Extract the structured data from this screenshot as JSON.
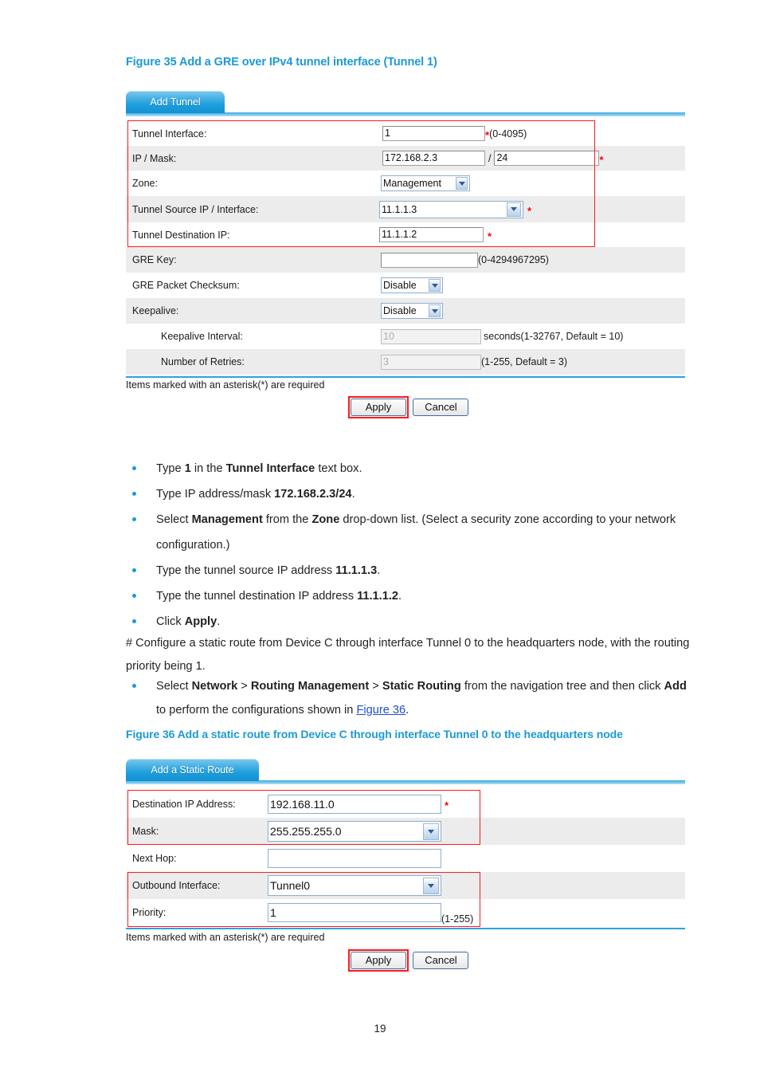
{
  "page": {
    "number": "19"
  },
  "figure35": {
    "caption": "Figure 35 Add a GRE over IPv4 tunnel interface (Tunnel 1)",
    "tab_label": "Add Tunnel",
    "rows": [
      {
        "label": "Tunnel Interface:",
        "value": "1",
        "required": "*",
        "hint": "(0-4095)"
      },
      {
        "label": "IP / Mask:",
        "value": "172.168.2.3",
        "mask": "24",
        "separator": "/",
        "required": "*"
      },
      {
        "label": "Zone:",
        "value": "Management"
      },
      {
        "label": "Tunnel Source IP / Interface:",
        "value": "11.1.1.3",
        "required": "*"
      },
      {
        "label": "Tunnel Destination IP:",
        "value": "11.1.1.2",
        "required": "*"
      },
      {
        "label": "GRE Key:",
        "value": "",
        "hint": "(0-4294967295)"
      },
      {
        "label": "GRE Packet Checksum:",
        "value": "Disable"
      },
      {
        "label": "Keepalive:",
        "value": "Disable"
      },
      {
        "label": "Keepalive Interval:",
        "value": "10",
        "hint": "seconds(1-32767, Default = 10)"
      },
      {
        "label": "Number of Retries:",
        "value": "3",
        "hint": "(1-255, Default = 3)"
      }
    ],
    "required_note": "Items marked with an asterisk(*) are required",
    "apply_label": "Apply",
    "cancel_label": "Cancel"
  },
  "steps1": [
    "Type <b>1</b> in the <b>Tunnel Interface</b> text box.",
    "Type IP address/mask <b>172.168.2.3/24</b>.",
    "Select <b>Management</b> from the <b>Zone</b> drop-down list. (Select a security zone according to your network configuration.)",
    "Type the tunnel source IP address <b>11.1.1.3</b>.",
    "Type the tunnel destination IP address <b>11.1.1.2</b>.",
    "Click <b>Apply</b>."
  ],
  "paragraph": "# Configure a static route from Device C through interface Tunnel 0 to the headquarters node, with the routing priority being 1.",
  "steps2": [
    "Select <b>Network</b> &gt; <b>Routing Management</b> &gt; <b>Static Routing</b> from the navigation tree and then click <b>Add</b> to perform the configurations shown in <span class=\"link\">Figure 36</span>."
  ],
  "figure36": {
    "caption": "Figure 36 Add a static route from Device C through interface Tunnel 0 to the headquarters node",
    "tab_label": "Add a Static Route",
    "rows": [
      {
        "label": "Destination IP Address:",
        "value": "192.168.11.0",
        "required": "*"
      },
      {
        "label": "Mask:",
        "value": "255.255.255.0"
      },
      {
        "label": "Next Hop:",
        "value": ""
      },
      {
        "label": "Outbound Interface:",
        "value": "Tunnel0"
      },
      {
        "label": "Priority:",
        "value": "1",
        "hint": "(1-255)"
      }
    ],
    "required_note": "Items marked with an asterisk(*) are required",
    "apply_label": "Apply",
    "cancel_label": "Cancel"
  },
  "colors": {
    "accent_blue": "#1b9ad6",
    "highlight_red": "#ff1a1a",
    "row_stripe": "#ececec",
    "link_blue": "#1b4fd6"
  }
}
